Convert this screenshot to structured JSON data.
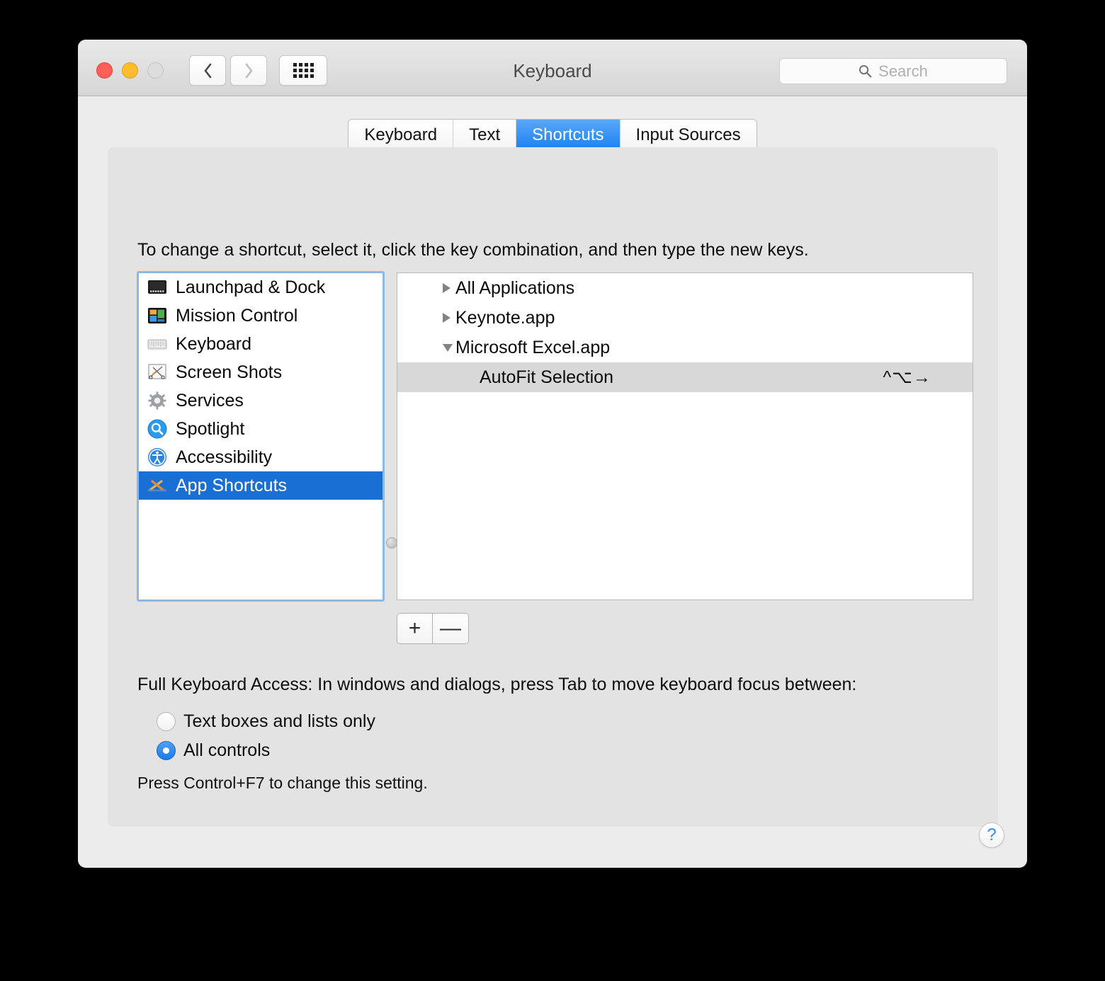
{
  "window": {
    "title": "Keyboard",
    "traffic_lights": [
      "close",
      "minimize",
      "zoom"
    ],
    "nav": {
      "back": "‹",
      "forward": "›"
    },
    "grid_button": "all-preferences"
  },
  "search": {
    "placeholder": "Search"
  },
  "tabs": [
    {
      "label": "Keyboard",
      "active": false
    },
    {
      "label": "Text",
      "active": false
    },
    {
      "label": "Shortcuts",
      "active": true
    },
    {
      "label": "Input Sources",
      "active": false
    }
  ],
  "instruction": "To change a shortcut, select it, click the key combination, and then type the new keys.",
  "sidebar": {
    "items": [
      {
        "label": "Launchpad & Dock",
        "icon": "launchpad-dock-icon",
        "selected": false
      },
      {
        "label": "Mission Control",
        "icon": "mission-control-icon",
        "selected": false
      },
      {
        "label": "Keyboard",
        "icon": "keyboard-icon",
        "selected": false
      },
      {
        "label": "Screen Shots",
        "icon": "screen-shots-icon",
        "selected": false
      },
      {
        "label": "Services",
        "icon": "services-gear-icon",
        "selected": false
      },
      {
        "label": "Spotlight",
        "icon": "spotlight-icon",
        "selected": false
      },
      {
        "label": "Accessibility",
        "icon": "accessibility-icon",
        "selected": false
      },
      {
        "label": "App Shortcuts",
        "icon": "app-shortcuts-icon",
        "selected": true
      }
    ]
  },
  "shortcut_tree": {
    "rows": [
      {
        "label": "All Applications",
        "type": "parent",
        "expanded": false,
        "shortcut": "",
        "selected": false
      },
      {
        "label": "Keynote.app",
        "type": "parent",
        "expanded": false,
        "shortcut": "",
        "selected": false
      },
      {
        "label": "Microsoft Excel.app",
        "type": "parent",
        "expanded": true,
        "shortcut": "",
        "selected": false
      },
      {
        "label": "AutoFit Selection",
        "type": "child",
        "expanded": null,
        "shortcut": "^⌥→",
        "selected": true
      }
    ]
  },
  "list_buttons": {
    "add": "+",
    "remove": "—"
  },
  "full_keyboard_access": {
    "title": "Full Keyboard Access: In windows and dialogs, press Tab to move keyboard focus between:",
    "options": [
      {
        "label": "Text boxes and lists only",
        "selected": false
      },
      {
        "label": "All controls",
        "selected": true
      }
    ],
    "note": "Press Control+F7 to change this setting."
  },
  "help": {
    "label": "?"
  },
  "colors": {
    "accent_blue": "#1a7ef0",
    "selection_blue": "#1a6fd4",
    "focus_ring": "#8cb8e8",
    "row_selected_gray": "#d8d8d8",
    "window_bg": "#ececec",
    "content_bg": "#e3e3e3"
  }
}
